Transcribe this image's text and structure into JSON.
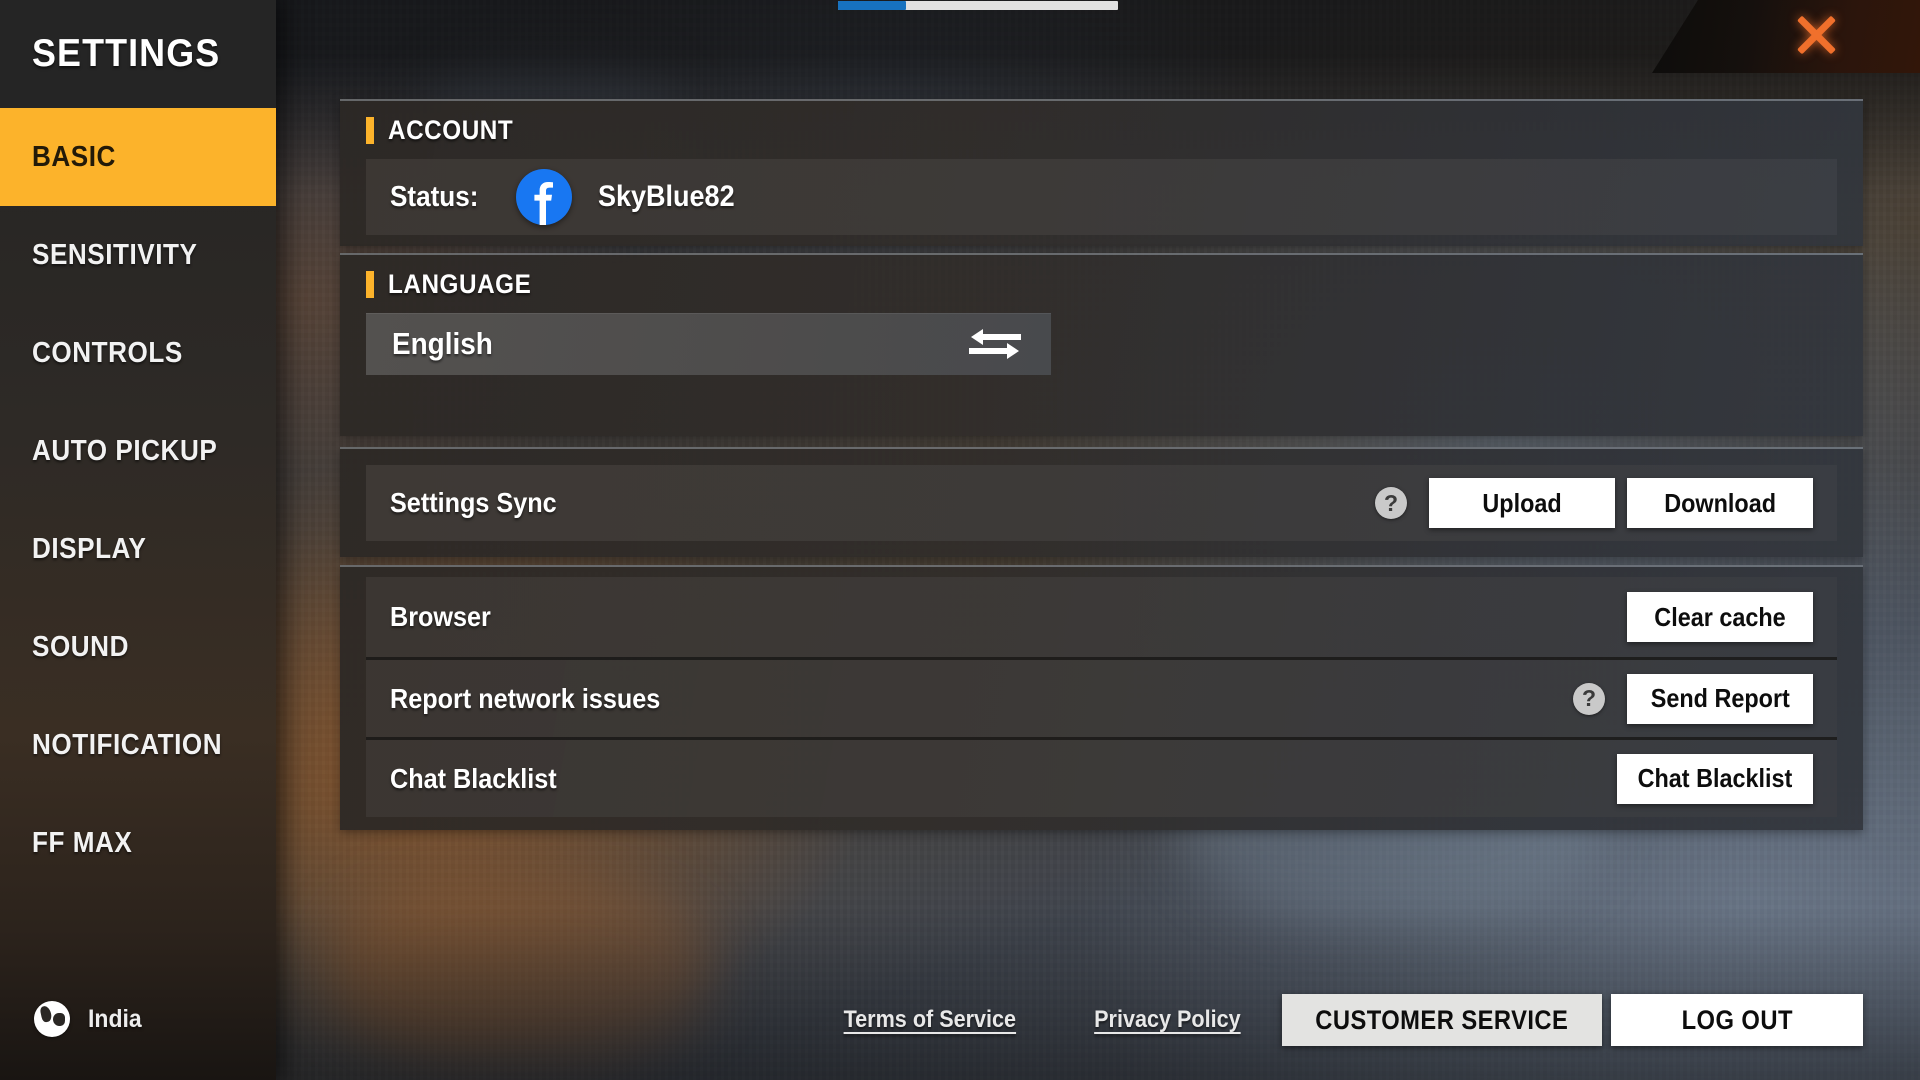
{
  "window": {
    "close_icon": "close-x-icon",
    "loading_bar_percent": 24
  },
  "sidebar": {
    "title": "SETTINGS",
    "items": [
      {
        "label": "BASIC",
        "active": true
      },
      {
        "label": "SENSITIVITY",
        "active": false
      },
      {
        "label": "CONTROLS",
        "active": false
      },
      {
        "label": "AUTO PICKUP",
        "active": false
      },
      {
        "label": "DISPLAY",
        "active": false
      },
      {
        "label": "SOUND",
        "active": false
      },
      {
        "label": "NOTIFICATION",
        "active": false
      },
      {
        "label": "FF MAX",
        "active": false
      }
    ],
    "region": {
      "icon": "globe-icon",
      "label": "India"
    }
  },
  "account": {
    "section_title": "ACCOUNT",
    "status_label": "Status:",
    "provider_icon": "facebook-icon",
    "username": "SkyBlue82"
  },
  "language": {
    "section_title": "LANGUAGE",
    "selected": "English",
    "swap_icon": "swap-arrows-icon"
  },
  "settings_sync": {
    "label": "Settings Sync",
    "help_icon": "question-mark-icon",
    "help_glyph": "?",
    "upload_label": "Upload",
    "download_label": "Download"
  },
  "misc_rows": [
    {
      "label": "Browser",
      "has_help": false,
      "help_glyph": "?",
      "button": "Clear cache"
    },
    {
      "label": "Report network issues",
      "has_help": true,
      "help_glyph": "?",
      "button": "Send Report"
    },
    {
      "label": "Chat Blacklist",
      "has_help": false,
      "help_glyph": "?",
      "button": "Chat Blacklist"
    }
  ],
  "footer": {
    "terms_label": "Terms of Service",
    "privacy_label": "Privacy Policy",
    "customer_service_label": "CUSTOMER SERVICE",
    "logout_label": "LOG OUT"
  },
  "colors": {
    "accent_yellow": "#fcb32b",
    "close_x": "#f0702c",
    "facebook_blue": "#1877f2",
    "panel_bg": "#2f2c29",
    "row_bg": "#3e3935",
    "button_white": "#ffffff"
  }
}
